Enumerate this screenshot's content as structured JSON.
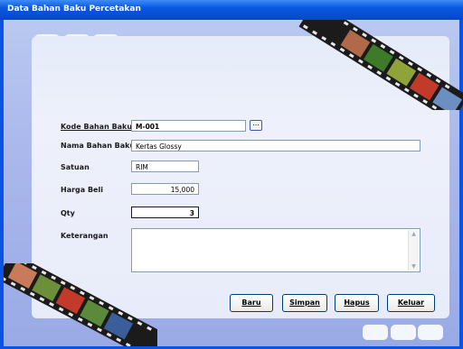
{
  "window": {
    "title": "Data Bahan Baku Percetakan"
  },
  "form": {
    "kode": {
      "label": "Kode Bahan Baku",
      "value": "M-001",
      "browse": "..."
    },
    "nama": {
      "label": "Nama Bahan Baku",
      "value": "Kertas Glossy"
    },
    "satuan": {
      "label": "Satuan",
      "value": "RIM"
    },
    "harga": {
      "label": "Harga Beli",
      "value": "15,000"
    },
    "qty": {
      "label": "Qty",
      "value": "3"
    },
    "keterangan": {
      "label": "Keterangan",
      "value": ""
    }
  },
  "buttons": {
    "baru": "Baru",
    "simpan": "Simpan",
    "hapus": "Hapus",
    "keluar": "Keluar"
  },
  "icons": {
    "scroll_up": "scroll-up-arrow-icon",
    "scroll_down": "scroll-down-arrow-icon",
    "film": "film-strip-decoration"
  },
  "colors": {
    "titlebar": "#0a57e0",
    "client": "#aab8ec",
    "panel": "#eef1fb"
  }
}
